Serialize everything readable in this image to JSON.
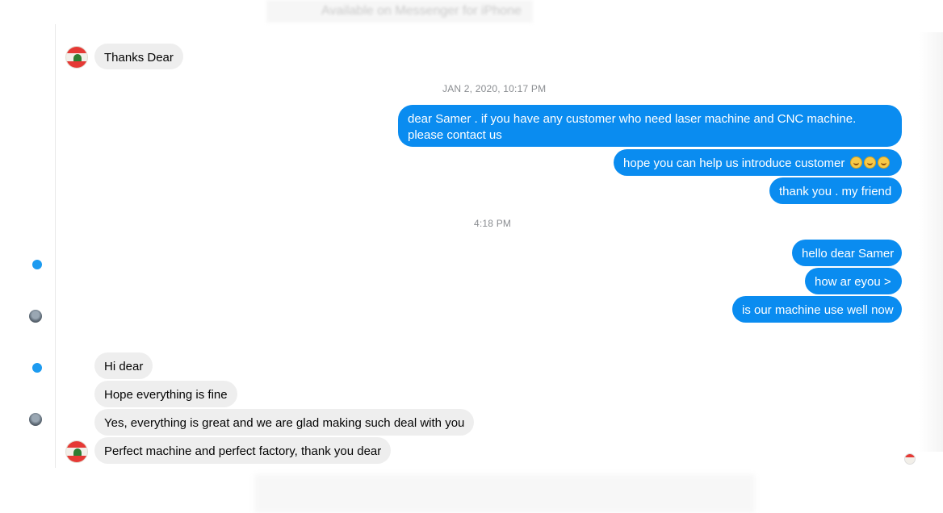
{
  "header": {
    "conversation_hint": "Available on Messenger for iPhone"
  },
  "incoming_top": {
    "text": "Thanks Dear"
  },
  "timestamps": {
    "first": "JAN 2, 2020, 10:17 PM",
    "second": "4:18 PM"
  },
  "outgoing_group_1": [
    {
      "text": "dear Samer . if you have any customer who need laser machine and CNC machine. please contact us"
    },
    {
      "text": "hope you can help us introduce customer"
    },
    {
      "text": "thank you . my friend"
    }
  ],
  "outgoing_group_2": [
    {
      "text": "hello dear Samer"
    },
    {
      "text": "how ar eyou >"
    },
    {
      "text": "is our machine use well now"
    }
  ],
  "incoming_group": [
    {
      "text": "Hi dear"
    },
    {
      "text": "Hope everything is fine"
    },
    {
      "text": "Yes, everything is great and we are glad making such deal with you"
    },
    {
      "text": "Perfect machine and perfect factory, thank you dear"
    }
  ],
  "emoji": {
    "name": "smiling-face-icon",
    "count": 3
  },
  "colors": {
    "outgoing_bubble": "#0a8cf0",
    "incoming_bubble": "#eeeeee",
    "unread_dot": "#1d9bf0"
  }
}
